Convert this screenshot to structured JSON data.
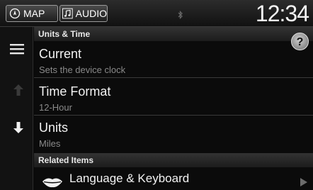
{
  "topbar": {
    "map_label": "MAP",
    "audio_label": "AUDIO",
    "clock": "12:34"
  },
  "help_label": "?",
  "sections": {
    "units_time": "Units & Time",
    "related": "Related Items"
  },
  "items": [
    {
      "title": "Current",
      "subtitle": "Sets the device clock"
    },
    {
      "title": "Time Format",
      "subtitle": "12-Hour"
    },
    {
      "title": "Units",
      "subtitle": "Miles"
    }
  ],
  "related": {
    "label": "Language & Keyboard"
  },
  "icons": {
    "map": "compass-icon",
    "audio": "music-note-icon",
    "bluetooth": "bluetooth-icon",
    "menu": "menu-icon",
    "up": "arrow-up-icon",
    "down": "arrow-down-icon",
    "language": "lips-icon",
    "chevron": "chevron-right-icon"
  }
}
